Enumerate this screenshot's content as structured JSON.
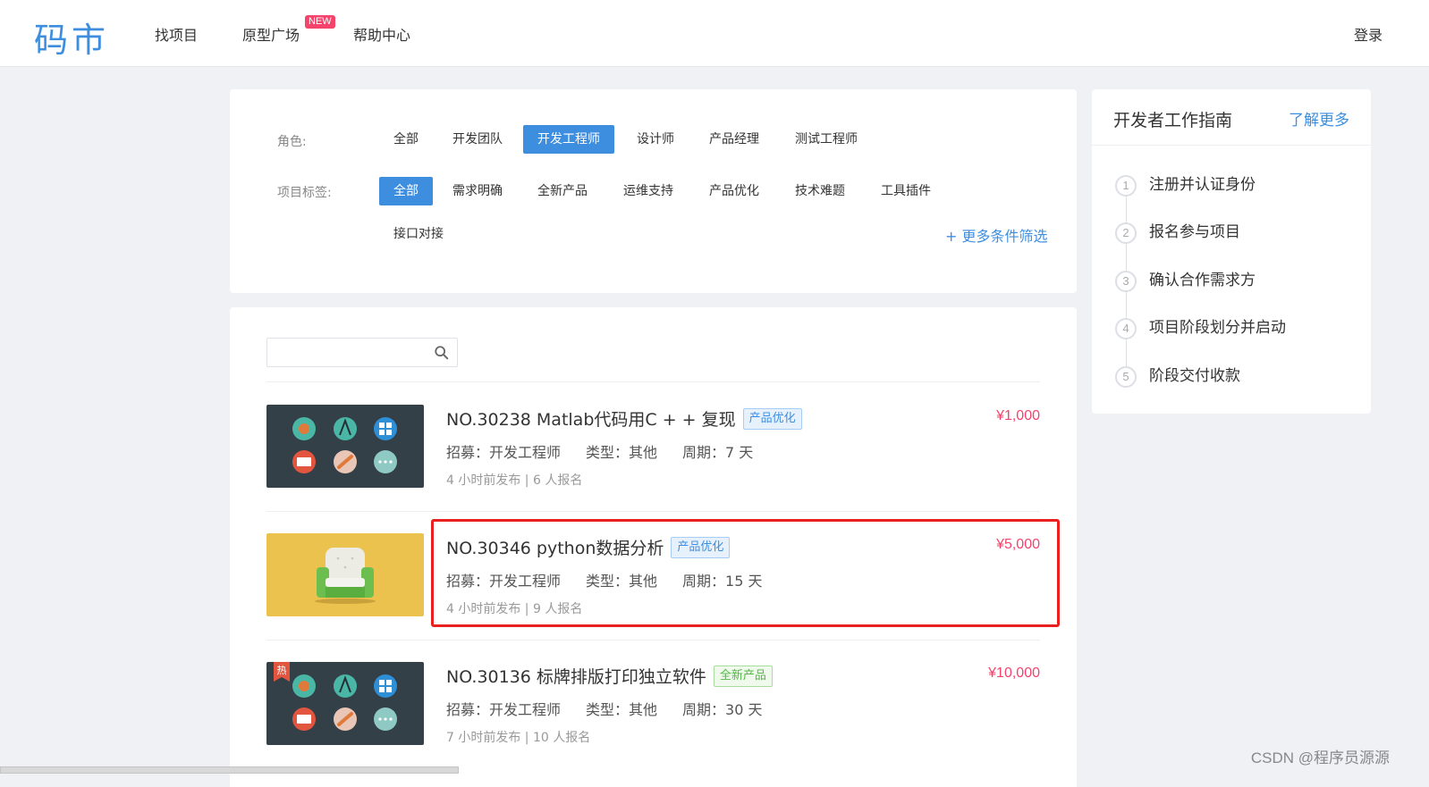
{
  "header": {
    "logo": "码市",
    "nav": [
      "找项目",
      "原型广场",
      "帮助中心"
    ],
    "new_badge": "NEW",
    "login": "登录"
  },
  "filters": {
    "role_label": "角色:",
    "roles": [
      "全部",
      "开发团队",
      "开发工程师",
      "设计师",
      "产品经理",
      "测试工程师"
    ],
    "active_role": "开发工程师",
    "tag_label": "项目标签:",
    "tags": [
      "全部",
      "需求明确",
      "全新产品",
      "运维支持",
      "产品优化",
      "技术难题",
      "工具插件",
      "接口对接"
    ],
    "active_tag": "全部",
    "more": "+ 更多条件筛选"
  },
  "search": {
    "placeholder": ""
  },
  "projects": [
    {
      "title": "NO.30238  Matlab代码用C + + 复现",
      "tag": "产品优化",
      "price": "¥1,000",
      "recruit": "招募：开发工程师",
      "type": "类型：其他",
      "period": "周期：7 天",
      "sub": "4 小时前发布  |  6 人报名",
      "thumb": "dark-icons"
    },
    {
      "title": "NO.30346  python数据分析",
      "tag": "产品优化",
      "price": "¥5,000",
      "recruit": "招募：开发工程师",
      "type": "类型：其他",
      "period": "周期：15 天",
      "sub": "4 小时前发布  |  9 人报名",
      "thumb": "yellow-sofa",
      "highlighted": true
    },
    {
      "title": "NO.30136  标牌排版打印独立软件",
      "tag": "全新产品",
      "price": "¥10,000",
      "recruit": "招募：开发工程师",
      "type": "类型：其他",
      "period": "周期：30 天",
      "sub": "7 小时前发布  |  10 人报名",
      "thumb": "dark-icons",
      "hot": "热"
    }
  ],
  "guide": {
    "title": "开发者工作指南",
    "more": "了解更多",
    "steps": [
      {
        "num": "1",
        "text": "注册并认证身份"
      },
      {
        "num": "2",
        "text": "报名参与项目"
      },
      {
        "num": "3",
        "text": "确认合作需求方"
      },
      {
        "num": "4",
        "text": "项目阶段划分并启动"
      },
      {
        "num": "5",
        "text": "阶段交付收款"
      }
    ]
  },
  "watermark": "CSDN @程序员源源",
  "colors": {
    "accent": "#3e8ee0",
    "price": "#f5436c",
    "highlight": "#e8201f"
  }
}
